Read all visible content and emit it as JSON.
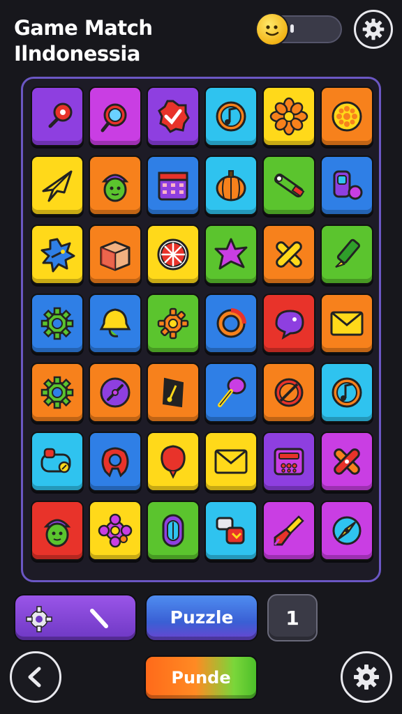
{
  "app": {
    "title_line1": "Game Match",
    "title_line2": "Ilndonessia"
  },
  "colors": {
    "purple": "#8e3fe0",
    "magenta": "#c93ee3",
    "cyan": "#2fc3ef",
    "yellow": "#ffd91a",
    "orange": "#f7811c",
    "green": "#5bc42e",
    "blue": "#2f7fe6",
    "red": "#e8332a",
    "board_border": "#6b57c4"
  },
  "board": {
    "rows": [
      [
        {
          "color": "purple",
          "icon": "lollipop-icon"
        },
        {
          "color": "magenta",
          "icon": "magnifier-icon"
        },
        {
          "color": "purple",
          "icon": "checkmark-badge-icon"
        },
        {
          "color": "cyan",
          "icon": "music-note-icon"
        },
        {
          "color": "yellow",
          "icon": "flower-icon"
        },
        {
          "color": "orange",
          "icon": "cog-circle-icon"
        }
      ],
      [
        {
          "color": "yellow",
          "icon": "paper-plane-icon"
        },
        {
          "color": "orange",
          "icon": "acorn-face-icon"
        },
        {
          "color": "blue",
          "icon": "calendar-icon"
        },
        {
          "color": "cyan",
          "icon": "pumpkin-icon"
        },
        {
          "color": "green",
          "icon": "wrench-tool-icon"
        },
        {
          "color": "blue",
          "icon": "machine-icon"
        }
      ],
      [
        {
          "color": "yellow",
          "icon": "splat-icon"
        },
        {
          "color": "orange",
          "icon": "box-icon"
        },
        {
          "color": "yellow",
          "icon": "citrus-wheel-icon"
        },
        {
          "color": "green",
          "icon": "star-blob-icon"
        },
        {
          "color": "orange",
          "icon": "cross-icon"
        },
        {
          "color": "green",
          "icon": "highlighter-icon"
        }
      ],
      [
        {
          "color": "blue",
          "icon": "gear-icon"
        },
        {
          "color": "blue",
          "icon": "bell-blob-icon"
        },
        {
          "color": "green",
          "icon": "sun-gear-icon"
        },
        {
          "color": "blue",
          "icon": "ring-icon"
        },
        {
          "color": "red",
          "icon": "chat-bubble-icon"
        },
        {
          "color": "orange",
          "icon": "envelope-icon"
        }
      ],
      [
        {
          "color": "orange",
          "icon": "gear-icon"
        },
        {
          "color": "orange",
          "icon": "dial-icon"
        },
        {
          "color": "orange",
          "icon": "music-tag-icon"
        },
        {
          "color": "blue",
          "icon": "maraca-icon"
        },
        {
          "color": "orange",
          "icon": "no-sign-icon"
        },
        {
          "color": "cyan",
          "icon": "music-note-icon"
        }
      ],
      [
        {
          "color": "cyan",
          "icon": "controller-icon"
        },
        {
          "color": "blue",
          "icon": "ring-blob-icon"
        },
        {
          "color": "yellow",
          "icon": "balloon-icon"
        },
        {
          "color": "yellow",
          "icon": "envelope-icon"
        },
        {
          "color": "purple",
          "icon": "radio-icon"
        },
        {
          "color": "magenta",
          "icon": "bandage-cross-icon"
        }
      ],
      [
        {
          "color": "red",
          "icon": "acorn-face-icon"
        },
        {
          "color": "yellow",
          "icon": "flower-gear-icon"
        },
        {
          "color": "green",
          "icon": "capsule-icon"
        },
        {
          "color": "cyan",
          "icon": "robot-icon"
        },
        {
          "color": "magenta",
          "icon": "brush-icon"
        },
        {
          "color": "magenta",
          "icon": "compass-icon"
        }
      ]
    ]
  },
  "controls": {
    "puzzle_label": "Puzzle",
    "count_label": "1",
    "play_label": "Punde"
  }
}
